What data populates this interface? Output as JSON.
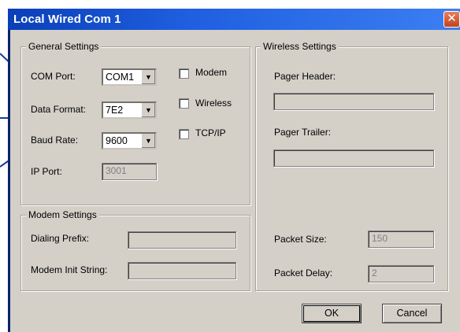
{
  "window": {
    "title": "Local Wired Com 1",
    "close_glyph": "✕"
  },
  "general": {
    "legend": "General Settings",
    "com_port_label": "COM Port:",
    "com_port_value": "COM1",
    "data_format_label": "Data Format:",
    "data_format_value": "7E2",
    "baud_rate_label": "Baud Rate:",
    "baud_rate_value": "9600",
    "ip_port_label": "IP Port:",
    "ip_port_value": "3001",
    "modem_label": "Modem",
    "wireless_label": "Wireless",
    "tcpip_label": "TCP/IP",
    "dropdown_glyph": "▼"
  },
  "modem": {
    "legend": "Modem Settings",
    "dialing_prefix_label": "Dialing Prefix:",
    "dialing_prefix_value": "",
    "init_string_label": "Modem Init String:",
    "init_string_value": ""
  },
  "wireless": {
    "legend": "Wireless Settings",
    "pager_header_label": "Pager Header:",
    "pager_header_value": "",
    "pager_trailer_label": "Pager Trailer:",
    "pager_trailer_value": "",
    "packet_size_label": "Packet Size:",
    "packet_size_value": "150",
    "packet_delay_label": "Packet Delay:",
    "packet_delay_value": "2"
  },
  "buttons": {
    "ok": "OK",
    "cancel": "Cancel"
  },
  "colors": {
    "title_bar": "#1f5fe0",
    "dialog_face": "#d4d0c8",
    "leader_line": "#1a3a9a"
  }
}
